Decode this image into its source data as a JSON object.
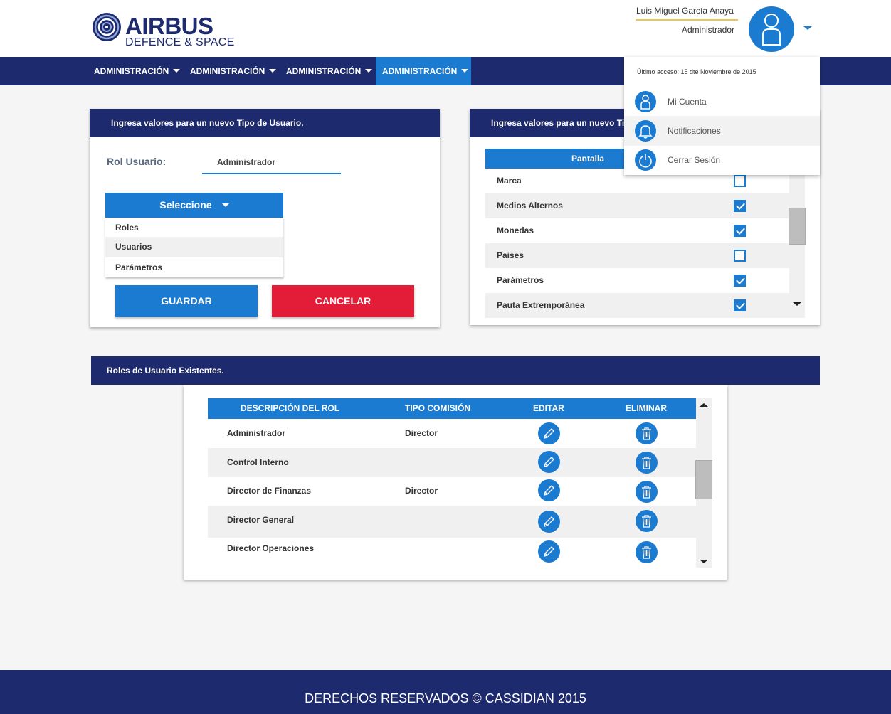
{
  "brand": {
    "line1": "AIRBUS",
    "line2": "DEFENCE & SPACE"
  },
  "user": {
    "name": "Luis Miguel García Anaya",
    "role": "Administrador"
  },
  "nav": {
    "items": [
      {
        "label": "ADMINISTRACIÓN"
      },
      {
        "label": "ADMINISTRACIÓN"
      },
      {
        "label": "ADMINISTRACIÓN"
      },
      {
        "label": "ADMINISTRACIÓN"
      }
    ]
  },
  "account_menu": {
    "last_access": "Último acceso: 15 dte Noviembre de 2015",
    "items": [
      {
        "label": "Mi Cuenta",
        "icon": "user-icon"
      },
      {
        "label": "Notificaciones",
        "icon": "bell-icon"
      },
      {
        "label": "Cerrar Sesión",
        "icon": "power-icon"
      }
    ]
  },
  "new_user_type": {
    "title": "Ingresa valores para un nuevo Tipo de Usuario.",
    "rol_label": "Rol Usuario:",
    "rol_value": "Administrador",
    "select_label": "Seleccione",
    "options": [
      "Roles",
      "Usuarios",
      "Parámetros"
    ],
    "save_label": "GUARDAR",
    "cancel_label": "CANCELAR"
  },
  "screens_panel": {
    "title": "Ingresa valores para un nuevo Ti",
    "column": "Pantalla",
    "rows": [
      {
        "label": "Marca",
        "checked": false
      },
      {
        "label": "Medios Alternos",
        "checked": true
      },
      {
        "label": "Monedas",
        "checked": true
      },
      {
        "label": "Paises",
        "checked": false
      },
      {
        "label": "Parámetros",
        "checked": true
      },
      {
        "label": "Pauta Extremporánea",
        "checked": true
      }
    ]
  },
  "roles": {
    "title": "Roles de Usuario Existentes.",
    "headers": [
      "DESCRIPCIÓN DEL ROL",
      "TIPO COMISIÓN",
      "EDITAR",
      "ELIMINAR"
    ],
    "rows": [
      {
        "description": "Administrador",
        "commission": "Director"
      },
      {
        "description": "Control Interno",
        "commission": ""
      },
      {
        "description": "Director de Finanzas",
        "commission": "Director"
      },
      {
        "description": "Director General",
        "commission": ""
      },
      {
        "description": "Director Operaciones",
        "commission": ""
      }
    ]
  },
  "footer": {
    "text": "DERECHOS RESERVADOS © CASSIDIAN 2015"
  },
  "colors": {
    "navy": "#1e2a6e",
    "blue": "#1a7bd1",
    "red": "#e31d37",
    "gold": "#e8c84a"
  }
}
